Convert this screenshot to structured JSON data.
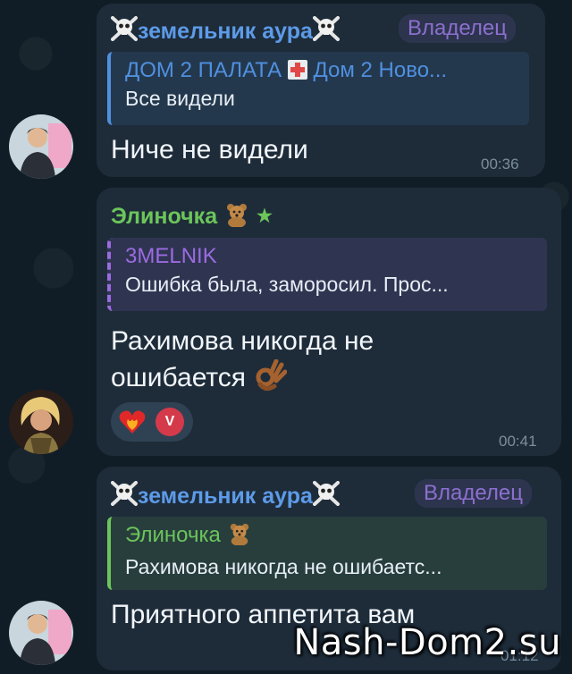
{
  "messages": [
    {
      "sender": "земельник аура",
      "sender_color": "#5d9be8",
      "role": "Владелец",
      "reply_name": "ДОМ 2 ПАЛАТА",
      "reply_name_suffix": "Дом 2 Ново...",
      "reply_color": "#4f90e0",
      "reply_text": "Все видели",
      "text": "Ниче не видели",
      "time": "00:36"
    },
    {
      "sender": "Элиночка",
      "sender_color": "#6cc55a",
      "reply_name": "3MELNIK",
      "reply_color": "#9b6be0",
      "reply_text": "Ошибка была, заморосил. Прос...",
      "text_line1": "Рахимова никогда не",
      "text_line2": "ошибается",
      "reaction_badge": "V",
      "time": "00:41"
    },
    {
      "sender": "земельник аура",
      "sender_color": "#5d9be8",
      "role": "Владелец",
      "reply_name": "Элиночка",
      "reply_color": "#6cc55a",
      "reply_text": "Рахимова никогда не ошибаетс...",
      "text": "Приятного аппетита вам",
      "time": "01:12"
    }
  ],
  "watermark": "Nash-Dom2.su"
}
